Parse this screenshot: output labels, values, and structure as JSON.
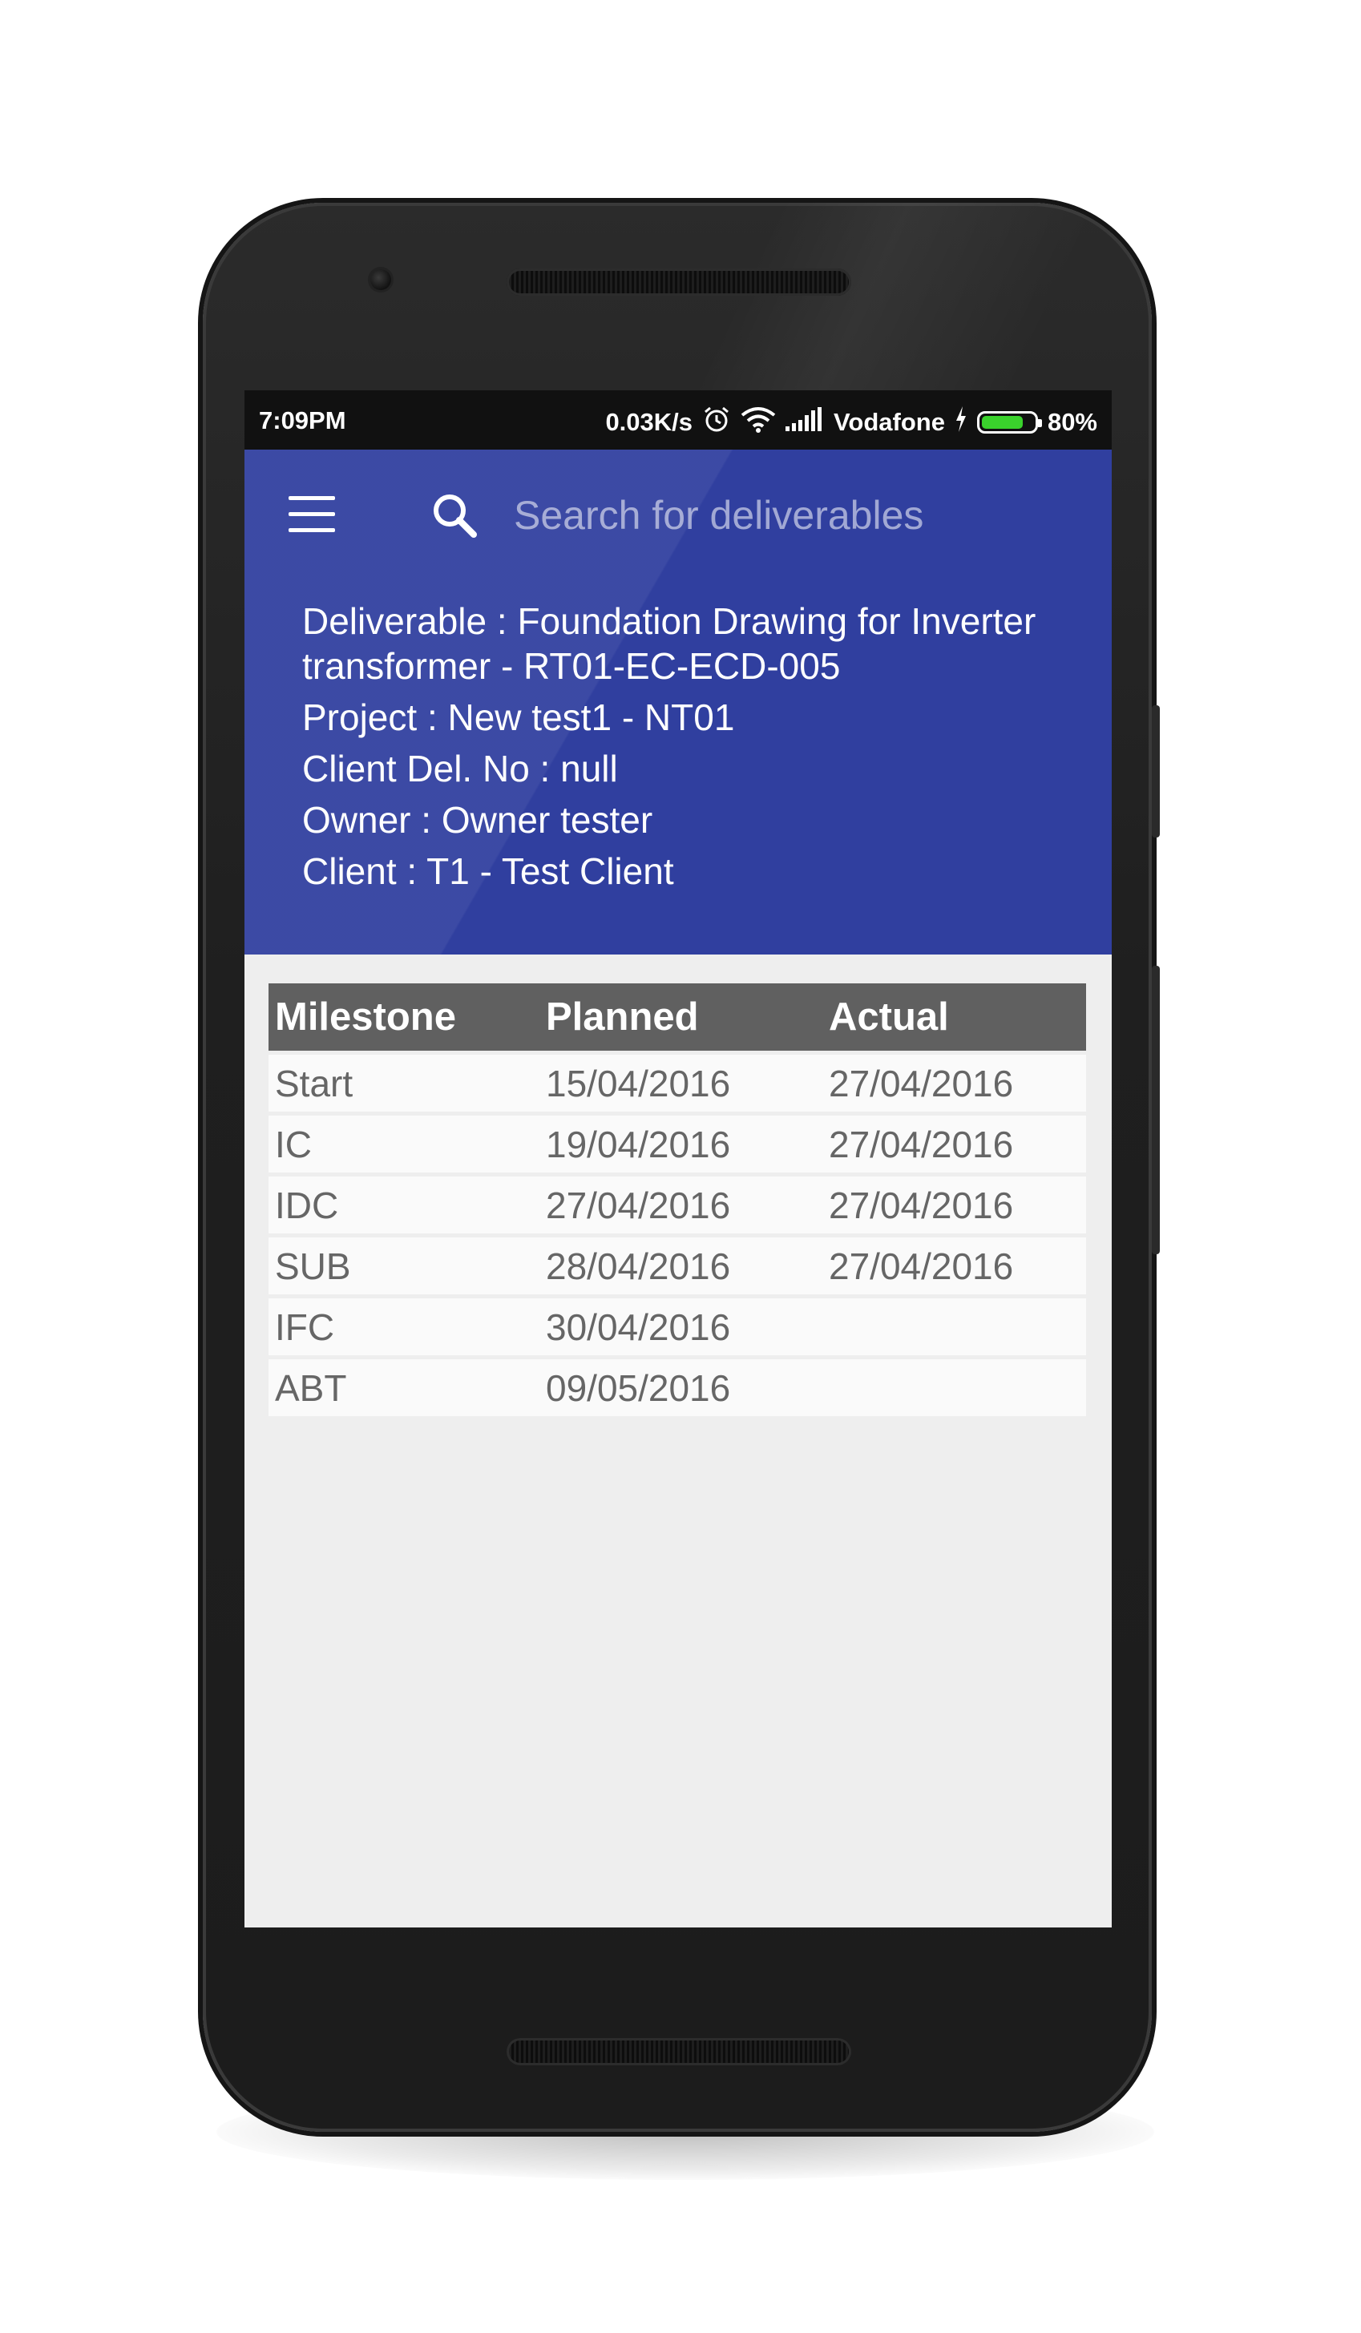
{
  "status_bar": {
    "time": "7:09PM",
    "speed": "0.03K/s",
    "carrier": "Vodafone",
    "battery": "80%",
    "battery_level": 0.8,
    "battery_color": "#3ad22c"
  },
  "app_bar": {
    "menu_icon": "hamburger-menu-icon",
    "search_icon": "search-icon",
    "search_placeholder": "Search for deliverables",
    "color": "#303f9f"
  },
  "details": {
    "deliverable": "Deliverable : Foundation Drawing for Inverter transformer - RT01-EC-ECD-005",
    "project": "Project : New test1 - NT01",
    "client_del_no": "Client Del. No : null",
    "owner": "Owner : Owner tester",
    "client": "Client : T1 - Test Client"
  },
  "milestones": {
    "columns": [
      "Milestone",
      "Planned",
      "Actual"
    ],
    "rows": [
      {
        "milestone": "Start",
        "planned": "15/04/2016",
        "actual": "27/04/2016"
      },
      {
        "milestone": "IC",
        "planned": "19/04/2016",
        "actual": "27/04/2016"
      },
      {
        "milestone": "IDC",
        "planned": "27/04/2016",
        "actual": "27/04/2016"
      },
      {
        "milestone": "SUB",
        "planned": "28/04/2016",
        "actual": "27/04/2016"
      },
      {
        "milestone": "IFC",
        "planned": "30/04/2016",
        "actual": ""
      },
      {
        "milestone": "ABT",
        "planned": "09/05/2016",
        "actual": ""
      }
    ]
  }
}
